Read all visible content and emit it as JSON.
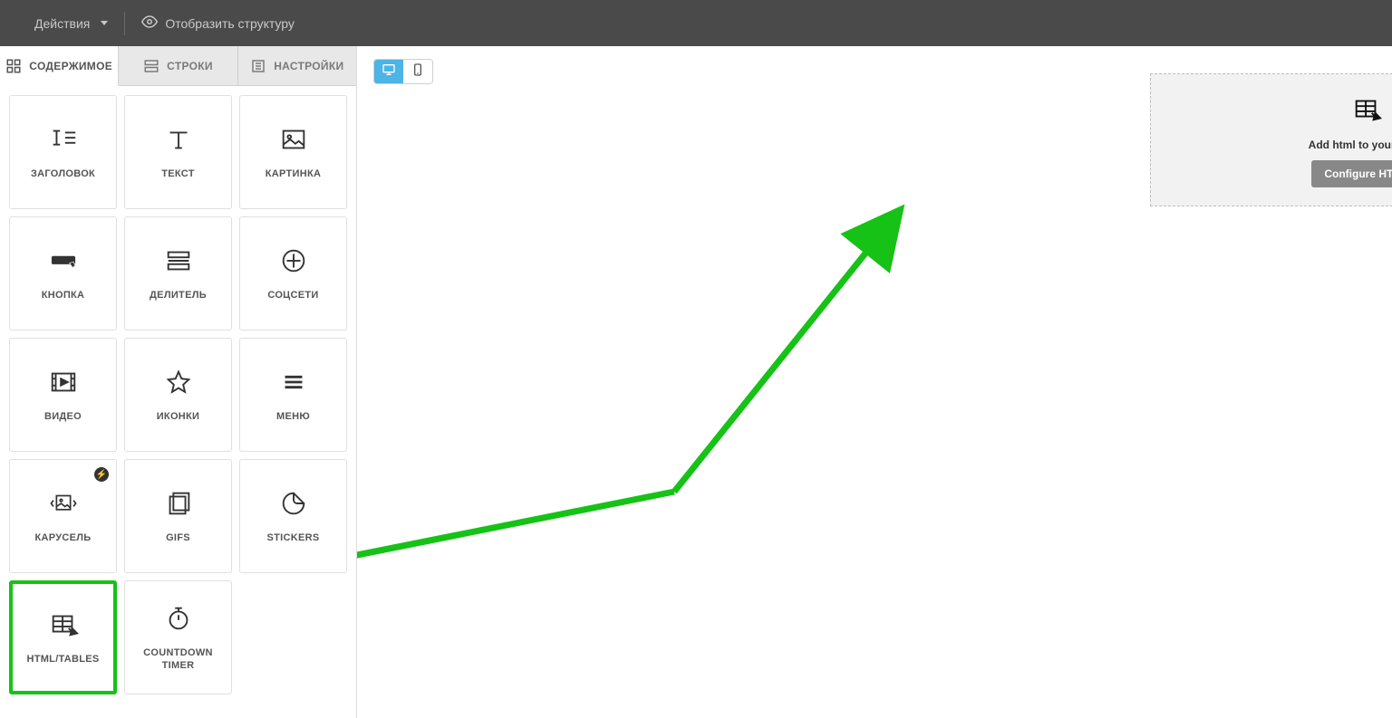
{
  "topbar": {
    "actions_label": "Действия",
    "display_structure_label": "Отобразить структуру"
  },
  "sidebar": {
    "tabs": {
      "content": "СОДЕРЖИМОЕ",
      "rows": "СТРОКИ",
      "settings": "НАСТРОЙКИ"
    },
    "tiles": [
      {
        "label": "ЗАГОЛОВОК"
      },
      {
        "label": "ТЕКСТ"
      },
      {
        "label": "КАРТИНКА"
      },
      {
        "label": "КНОПКА"
      },
      {
        "label": "ДЕЛИТЕЛЬ"
      },
      {
        "label": "СОЦСЕТИ"
      },
      {
        "label": "ВИДЕО"
      },
      {
        "label": "ИКОНКИ"
      },
      {
        "label": "МЕНЮ"
      },
      {
        "label": "КАРУСЕЛЬ"
      },
      {
        "label": "GIFS"
      },
      {
        "label": "STICKERS"
      },
      {
        "label": "HTML/TABLES"
      },
      {
        "label": "COUNTDOWN TIMER"
      }
    ]
  },
  "canvas": {
    "placeholder_text": "Add html to your letter",
    "configure_button": "Configure HTML"
  }
}
